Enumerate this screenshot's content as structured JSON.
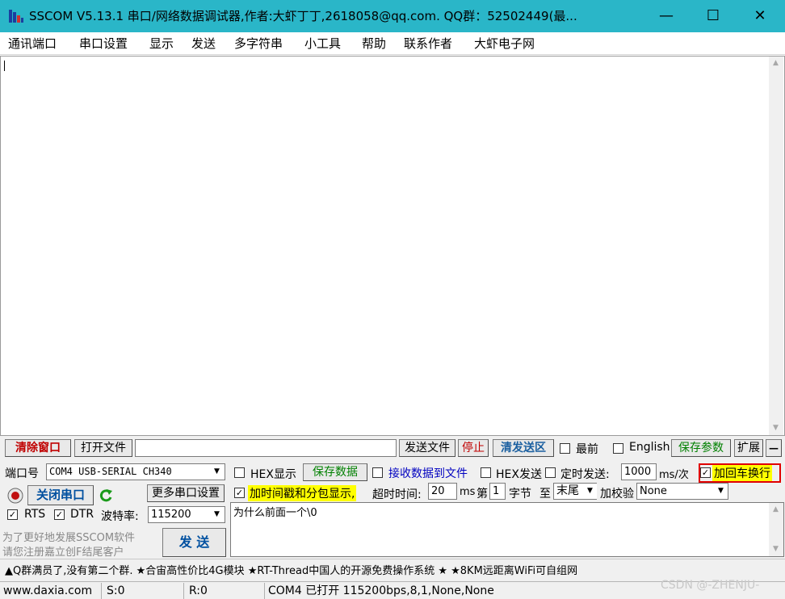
{
  "window": {
    "title": "SSCOM V5.13.1 串口/网络数据调试器,作者:大虾丁丁,2618058@qq.com. QQ群：52502449(最...",
    "controls": {
      "minimize": "—",
      "maximize": "☐",
      "close": "✕"
    }
  },
  "menu": [
    "通讯端口",
    "串口设置",
    "显示",
    "发送",
    "多字符串",
    "小工具",
    "帮助",
    "联系作者",
    "大虾电子网"
  ],
  "toolbar": {
    "clear_window": "清除窗口",
    "open_file": "打开文件",
    "file_path": "",
    "send_file": "发送文件",
    "stop": "停止",
    "clear_send": "清发送区",
    "topmost": "最前",
    "english": "English",
    "save_params": "保存参数",
    "expand": "扩展",
    "collapse": "—"
  },
  "port": {
    "port_label": "端口号",
    "port_value": "COM4 USB-SERIAL CH340",
    "more_settings": "更多串口设置",
    "close_port": "关闭串口",
    "rts": "RTS",
    "dtr": "DTR",
    "baud_label": "波特率:",
    "baud_value": "115200",
    "promo_line1": "为了更好地发展SSCOM软件",
    "promo_line2": "请您注册嘉立创F结尾客户",
    "send_button": "发 送"
  },
  "options": {
    "hex_display": "HEX显示",
    "save_data": "保存数据",
    "recv_to_file": "接收数据到文件",
    "hex_send": "HEX发送",
    "timed_send": "定时发送:",
    "timed_value": "1000",
    "timed_unit": "ms/次",
    "add_crlf": "加回车换行",
    "add_timestamp": "加时间戳和分包显示,",
    "timeout_label": "超时时间:",
    "timeout_value": "20",
    "timeout_unit": "ms",
    "byte_prefix": "第",
    "byte_value": "1",
    "byte_suffix": "字节",
    "to_label": "至",
    "end_value": "末尾",
    "checksum_label": "加校验",
    "checksum_value": "None",
    "send_text": "为什么前面一个\\0"
  },
  "ticker": "▲Q群满员了,没有第二个群. ★合宙高性价比4G模块 ★RT-Thread中国人的开源免费操作系统 ★ ★8KM远距离WiFi可自组网",
  "status": {
    "website": "www.daxia.com",
    "sent": "S:0",
    "received": "R:0",
    "port_status": "COM4 已打开  115200bps,8,1,None,None",
    "watermark": "CSDN @-ZHENJU-"
  }
}
